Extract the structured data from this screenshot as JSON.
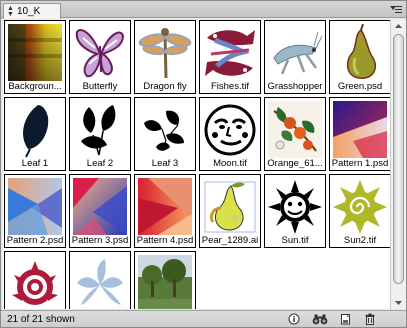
{
  "panel": {
    "tab_label": "10_K"
  },
  "items": [
    {
      "name": "Backgroun...",
      "thumb": "gradient-colors"
    },
    {
      "name": "Butterfly",
      "thumb": "butterfly"
    },
    {
      "name": "Dragon fly",
      "thumb": "dragonfly"
    },
    {
      "name": "Fishes.tif",
      "thumb": "fishes"
    },
    {
      "name": "Grasshopper",
      "thumb": "grasshopper"
    },
    {
      "name": "Green.psd",
      "thumb": "pear"
    },
    {
      "name": "Leaf 1",
      "thumb": "leaf1"
    },
    {
      "name": "Leaf 2",
      "thumb": "leaf2"
    },
    {
      "name": "Leaf 3",
      "thumb": "leaf3"
    },
    {
      "name": "Moon.tif",
      "thumb": "moon"
    },
    {
      "name": "Orange_61...",
      "thumb": "orange"
    },
    {
      "name": "Pattern 1.psd",
      "thumb": "pattern1"
    },
    {
      "name": "Pattern 2.psd",
      "thumb": "pattern2"
    },
    {
      "name": "Pattern 3.psd",
      "thumb": "pattern3"
    },
    {
      "name": "Pattern 4.psd",
      "thumb": "pattern4"
    },
    {
      "name": "Pear_1289.ai",
      "thumb": "pear-ai"
    },
    {
      "name": "Sun.tif",
      "thumb": "sun"
    },
    {
      "name": "Sun2.tif",
      "thumb": "sun2"
    },
    {
      "name": "",
      "thumb": "red-sun"
    },
    {
      "name": "",
      "thumb": "blue-leaves"
    },
    {
      "name": "",
      "thumb": "tree-photo"
    }
  ],
  "status": {
    "count_text": "21 of 21 shown"
  },
  "icons": {
    "info": "info-icon",
    "find": "binoculars-icon",
    "new": "new-item-icon",
    "delete": "trash-icon"
  }
}
